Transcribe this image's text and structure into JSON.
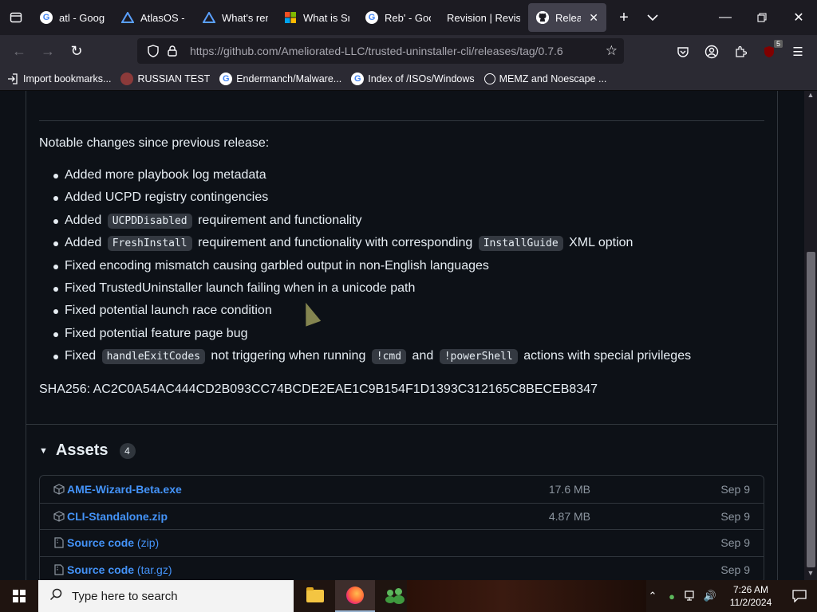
{
  "browser": {
    "tabs": [
      {
        "label": "atl - Googl",
        "favicon": "google-icon"
      },
      {
        "label": "AtlasOS - A",
        "favicon": "atlas-icon"
      },
      {
        "label": "What's rem",
        "favicon": "atlas-icon"
      },
      {
        "label": "What is Sm",
        "favicon": "microsoft-icon"
      },
      {
        "label": "Reb' - Goog",
        "favicon": "google-icon"
      },
      {
        "label": "Revision | Revis",
        "favicon": "revision-icon"
      },
      {
        "label": "Release",
        "favicon": "github-icon",
        "active": true
      }
    ],
    "url_domain": "https://github.com",
    "url_path": "/Ameliorated-LLC/trusted-uninstaller-cli/releases/tag/0.7.6",
    "ublock_count": "5",
    "bookmarks": [
      {
        "label": "Import bookmarks...",
        "icon": "import-icon"
      },
      {
        "label": "RUSSIAN TEST",
        "icon": "russian-test-icon"
      },
      {
        "label": "Endermanch/Malware...",
        "icon": "google-icon"
      },
      {
        "label": "Index of /ISOs/Windows",
        "icon": "google-icon"
      },
      {
        "label": "MEMZ and Noescape ...",
        "icon": "globe-icon"
      }
    ]
  },
  "release": {
    "notable": "Notable changes since previous release:",
    "changes": [
      [
        {
          "t": "Added more playbook log metadata"
        }
      ],
      [
        {
          "t": "Added UCPD registry contingencies"
        }
      ],
      [
        {
          "t": "Added "
        },
        {
          "c": "UCPDDisabled"
        },
        {
          "t": " requirement and functionality"
        }
      ],
      [
        {
          "t": "Added "
        },
        {
          "c": "FreshInstall"
        },
        {
          "t": " requirement and functionality with corresponding "
        },
        {
          "c": "InstallGuide"
        },
        {
          "t": " XML option"
        }
      ],
      [
        {
          "t": "Fixed encoding mismatch causing garbled output in non-English languages"
        }
      ],
      [
        {
          "t": "Fixed TrustedUninstaller launch failing when in a unicode path"
        }
      ],
      [
        {
          "t": "Fixed potential launch race condition"
        }
      ],
      [
        {
          "t": "Fixed potential feature page bug"
        }
      ],
      [
        {
          "t": "Fixed "
        },
        {
          "c": "handleExitCodes"
        },
        {
          "t": " not triggering when running "
        },
        {
          "c": "!cmd"
        },
        {
          "t": " and "
        },
        {
          "c": "!powerShell"
        },
        {
          "t": " actions with special privileges"
        }
      ]
    ],
    "sha": "SHA256: AC2C0A54AC444CD2B093CC74BCDE2EAE1C9B154F1D1393C312165C8BECEB8347"
  },
  "assets": {
    "title": "Assets",
    "count": "4",
    "items": [
      {
        "name": "AME-Wizard-Beta.exe",
        "suffix": "",
        "size": "17.6 MB",
        "date": "Sep 9",
        "icon": "package-icon"
      },
      {
        "name": "CLI-Standalone.zip",
        "suffix": "",
        "size": "4.87 MB",
        "date": "Sep 9",
        "icon": "package-icon"
      },
      {
        "name": "Source code",
        "suffix": " (zip)",
        "size": "",
        "date": "Sep 9",
        "icon": "file-zip-icon"
      },
      {
        "name": "Source code",
        "suffix": " (tar.gz)",
        "size": "",
        "date": "Sep 9",
        "icon": "file-zip-icon"
      }
    ]
  },
  "taskbar": {
    "search_placeholder": "Type here to search",
    "time": "7:26 AM",
    "date": "11/2/2024"
  }
}
